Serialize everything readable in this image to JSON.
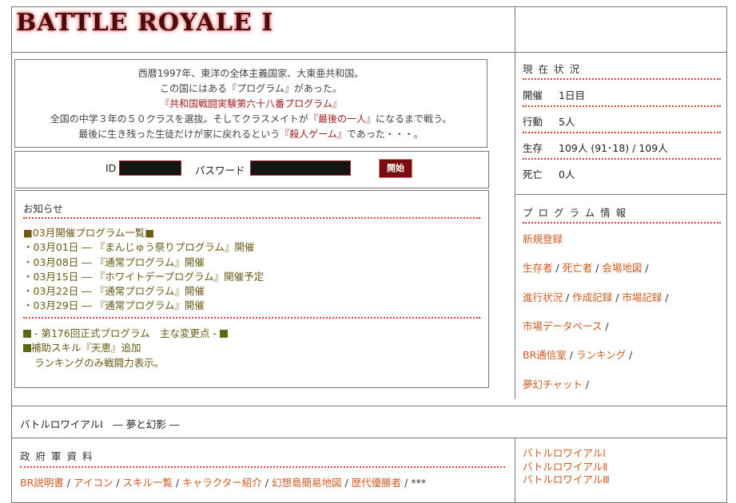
{
  "header": {
    "title": "BATTLE ROYALE Ⅰ"
  },
  "intro": {
    "line1": "西暦1997年、東洋の全体主義国家、大東亜共和国。",
    "line2": "この国にはある『プログラム』があった。",
    "line3": "『共和国戦闘実験第六十八番プログラム』",
    "line4_a": "全国の中学３年の５０クラスを選抜。そしてクラスメイトが",
    "line4_b": "『最後の一人』",
    "line4_c": "になるまで戦う。",
    "line5_a": "最後に生き残った生徒だけが家に戻れるという",
    "line5_b": "『殺人ゲーム』",
    "line5_c": "であった・・・。"
  },
  "login": {
    "id_label": "ID",
    "password_label": "パスワード",
    "start_button": "開始"
  },
  "news": {
    "heading": "お知らせ",
    "schedule_title": "■03月開催プログラム一覧■",
    "schedule": [
      "・03月01日 ― 『まんじゅう祭りプログラム』開催",
      "・03月08日 ― 『通常プログラム』開催",
      "・03月15日 ― 『ホワイトデープログラム』開催予定",
      "・03月22日 ― 『通常プログラム』開催",
      "・03月29日 ― 『通常プログラム』開催"
    ],
    "changes_title": "- 第176回正式プログラム　主な変更点 -",
    "skill_line": "補助スキル『天恵』追加",
    "ranking_line": "ランキングのみ戦闘力表示。"
  },
  "status": {
    "heading": "現在状況",
    "rows": [
      {
        "label": "開催",
        "value": "1日目"
      },
      {
        "label": "行動",
        "value": "5人"
      },
      {
        "label": "生存",
        "value": "109人 (91･18) / 109人"
      },
      {
        "label": "死亡",
        "value": "0人"
      }
    ]
  },
  "program_info": {
    "heading": "プログラム情報",
    "new_registration": "新規登録",
    "survivors": "生存者",
    "dead": "死亡者",
    "map": "会場地図",
    "progress": "進行状況",
    "creation_log": "作成記録",
    "market_log": "市場記録",
    "market_db": "市場データベース",
    "br_comm": "BR通信室",
    "ranking": "ランキング",
    "dream_chat": "夢幻チャット",
    "sep": "/"
  },
  "footer": {
    "subtitle": "バトルロワイアルⅠ　― 夢と幻影 ―",
    "gov_heading": "政府軍資料",
    "gov_links": [
      "BR説明書",
      "アイコン",
      "スキル一覧",
      "キャラクター紹介",
      "幻想島簡易地図",
      "歴代優勝者"
    ],
    "gov_more": "***",
    "series_links": [
      "バトルロワイアルⅠ",
      "バトルロワイアルⅡ",
      "バトルロワイアルⅢ"
    ]
  },
  "colors": {
    "accent": "#a41d1d",
    "link": "#d05a1e",
    "dotted": "#e03a3a",
    "olive": "#6b5a14"
  }
}
